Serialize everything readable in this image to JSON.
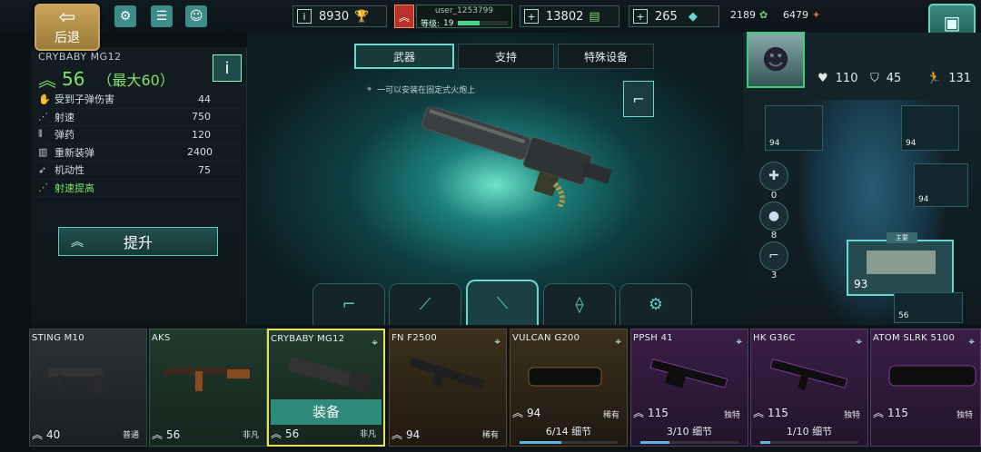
{
  "topbar": {
    "back_label": "后退",
    "gold": "8930",
    "username": "user_1253799",
    "level_label": "等级:",
    "level_value": "19",
    "level_progress": 0.45,
    "cash": "13802",
    "credits": "265",
    "res1": "2189",
    "res2": "6479"
  },
  "weapon": {
    "name": "CRYBABY MG12",
    "level": "56",
    "max_level": "（最大60）",
    "upgrade_label": "提升",
    "stats": [
      {
        "name": "受到子弹伤害",
        "value": "44"
      },
      {
        "name": "射速",
        "value": "750"
      },
      {
        "name": "弹药",
        "value": "120"
      },
      {
        "name": "重新装弹",
        "value": "2400"
      },
      {
        "name": "机动性",
        "value": "75"
      },
      {
        "name": "射速提高",
        "value": ""
      }
    ]
  },
  "tabs": [
    "武器",
    "支持",
    "特殊设备"
  ],
  "hint": "一可以安装在固定式火炮上",
  "character": {
    "health": "110",
    "armor": "45",
    "speed": "131",
    "equip_levels": {
      "vehicle": "94",
      "helmet": "94",
      "vest": "94"
    },
    "consumables": {
      "medkit": "0",
      "grenade": "8",
      "pistol": "3"
    },
    "primary_tag": "主要",
    "primary_level": "93",
    "secondary_level": "56"
  },
  "cards": [
    {
      "name": "STING M10",
      "level": "40",
      "rarity": "普通"
    },
    {
      "name": "AKS",
      "level": "56",
      "rarity": "非凡"
    },
    {
      "name": "CRYBABY MG12",
      "level": "56",
      "rarity": "非凡",
      "equip": "装备"
    },
    {
      "name": "FN F2500",
      "level": "94",
      "rarity": "稀有"
    },
    {
      "name": "VULCAN G200",
      "level": "94",
      "rarity": "稀有",
      "parts": "6/14 细节",
      "progress": 0.43
    },
    {
      "name": "PPSH 41",
      "level": "115",
      "rarity": "独特",
      "parts": "3/10 细节",
      "progress": 0.3
    },
    {
      "name": "HK G36C",
      "level": "115",
      "rarity": "独特",
      "parts": "1/10 细节",
      "progress": 0.1
    },
    {
      "name": "ATOM SLRK 5100",
      "level": "115",
      "rarity": "独特"
    }
  ]
}
